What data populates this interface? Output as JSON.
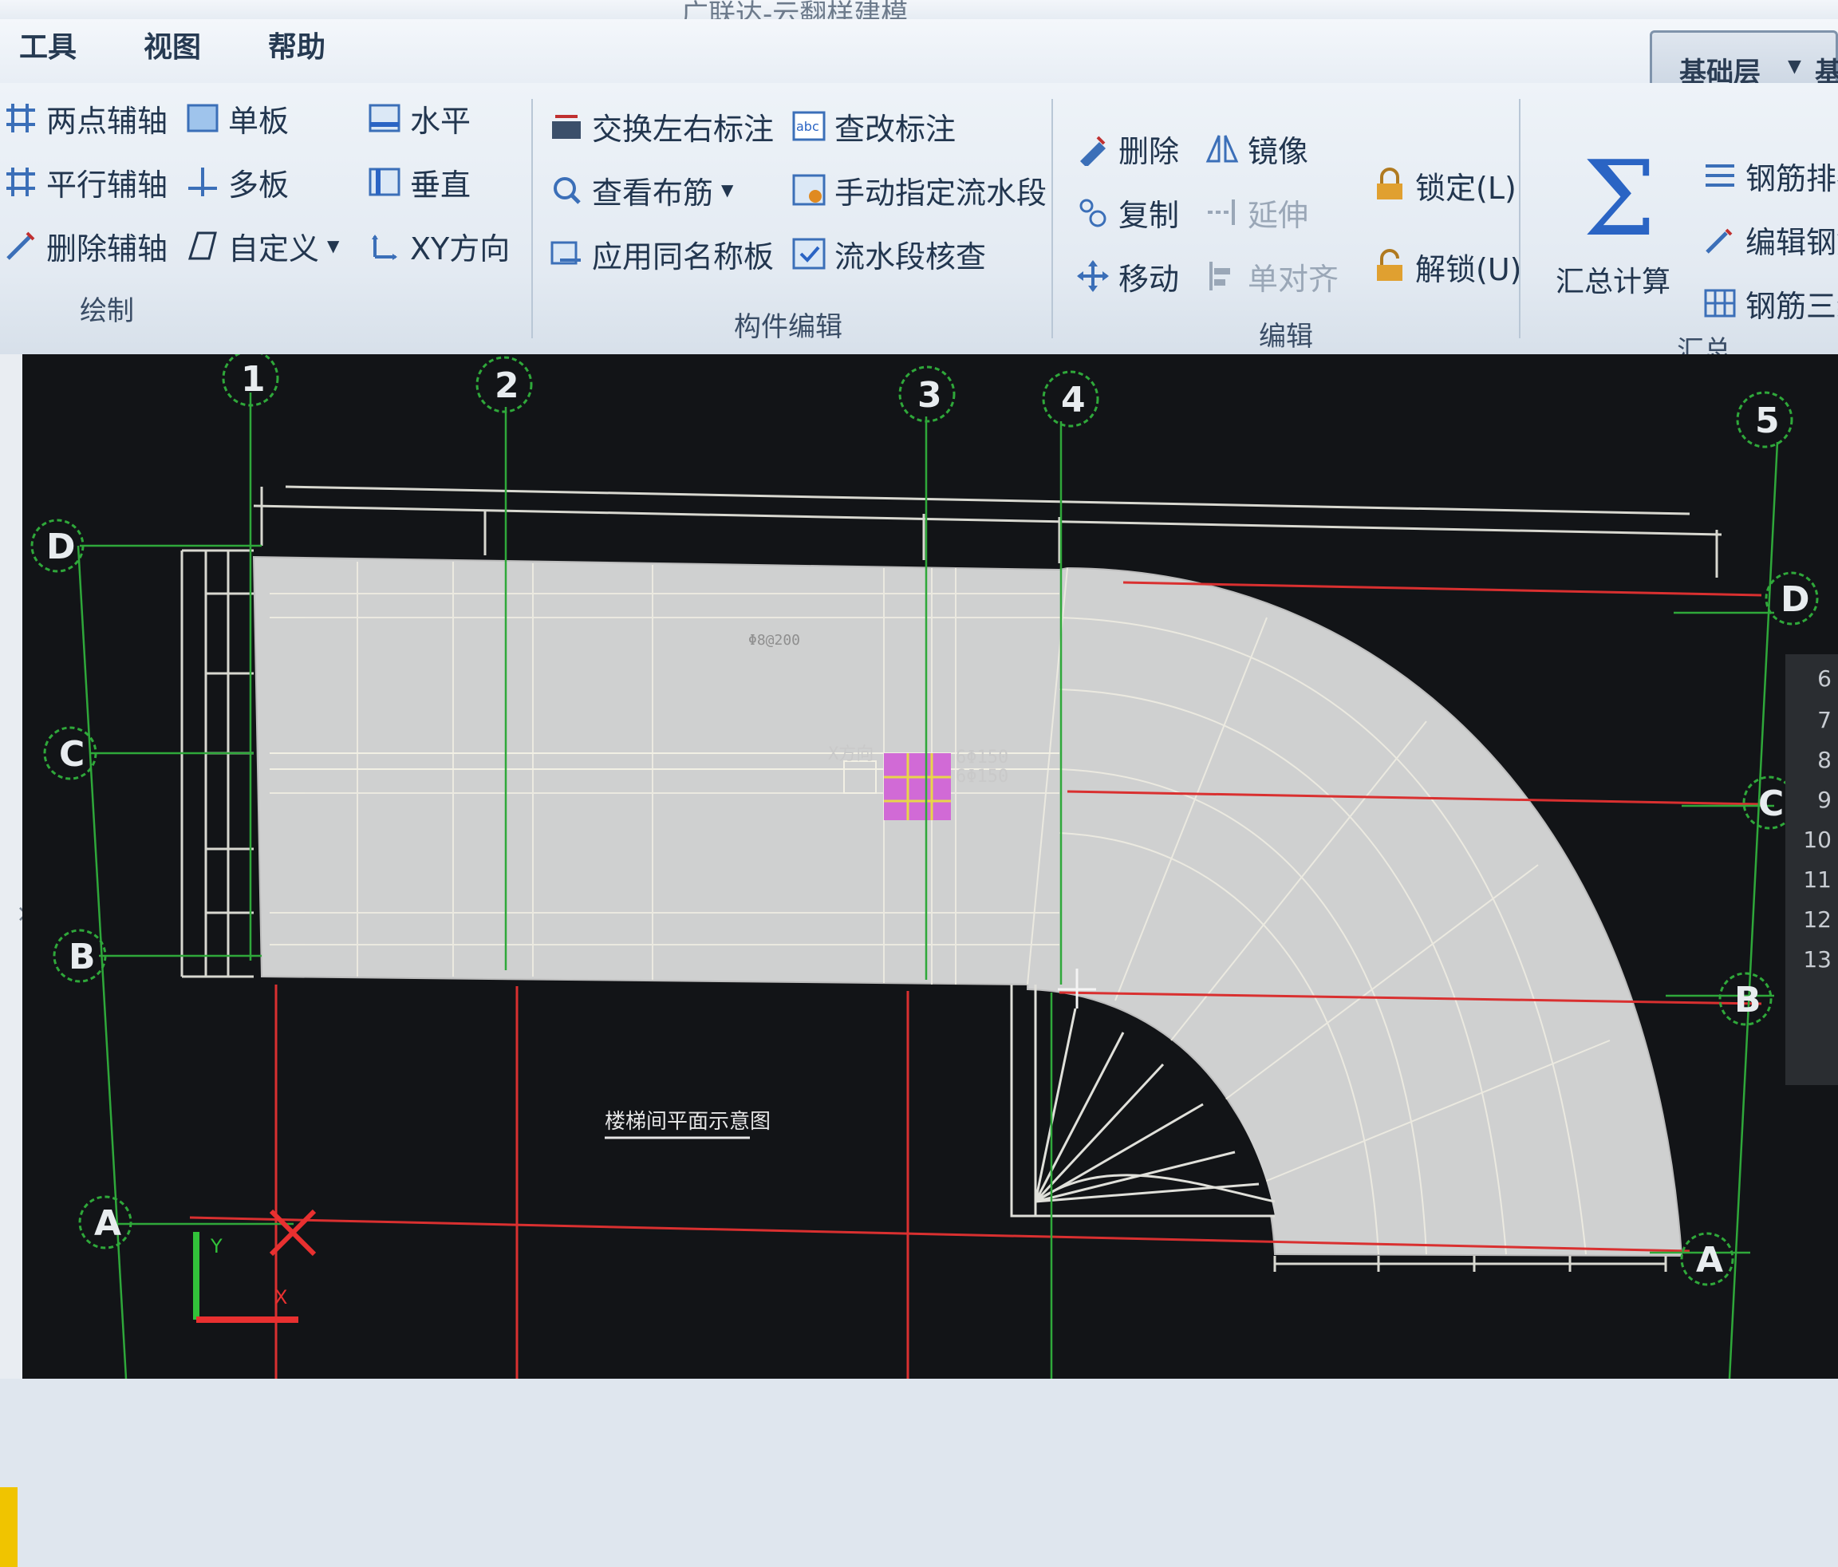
{
  "window": {
    "title": "…广联达-云翻样建模"
  },
  "menu": {
    "items": [
      "工具",
      "视图",
      "帮助"
    ]
  },
  "layer_selector": {
    "value": "基础层",
    "next_value": "基"
  },
  "ribbon": {
    "draw": {
      "label": "绘制",
      "buttons": [
        "两点辅轴",
        "单板",
        "水平",
        "平行辅轴",
        "多板",
        "垂直",
        "删除辅轴",
        "自定义",
        "XY方向"
      ]
    },
    "component_edit": {
      "label": "构件编辑",
      "buttons": [
        "交换左右标注",
        "查改标注",
        "查看布筋",
        "手动指定流水段",
        "应用同名称板",
        "流水段核查"
      ]
    },
    "edit": {
      "label": "编辑",
      "buttons": [
        "删除",
        "镜像",
        "复制",
        "延伸",
        "移动",
        "单对齐",
        "锁定(L)",
        "解锁(U)"
      ]
    },
    "summary": {
      "label": "汇总",
      "calc_button": "汇总计算",
      "buttons": [
        "钢筋排布",
        "编辑钢筋",
        "钢筋三维"
      ]
    }
  },
  "cad": {
    "grid_columns": [
      "1",
      "2",
      "3",
      "4",
      "5"
    ],
    "grid_rows_left": [
      "D",
      "C",
      "B",
      "A"
    ],
    "grid_rows_right": [
      "D",
      "C",
      "B",
      "A"
    ],
    "annotations": [
      "X方向",
      "6Φ150",
      "6Φ150",
      "Φ8@200"
    ],
    "note_text": "楼梯间平面示意图",
    "axis_x": "X",
    "axis_y": "Y"
  },
  "row_numbers": [
    "6",
    "7",
    "8",
    "9",
    "10",
    "11",
    "12",
    "13"
  ],
  "colors": {
    "canvas_bg": "#121417",
    "grid_green": "#2fa83a",
    "axis_red": "#d93030",
    "slab_fill": "#cfd0d0",
    "selection_magenta": "#d16ad6",
    "accent_blue": "#2a64c4"
  }
}
